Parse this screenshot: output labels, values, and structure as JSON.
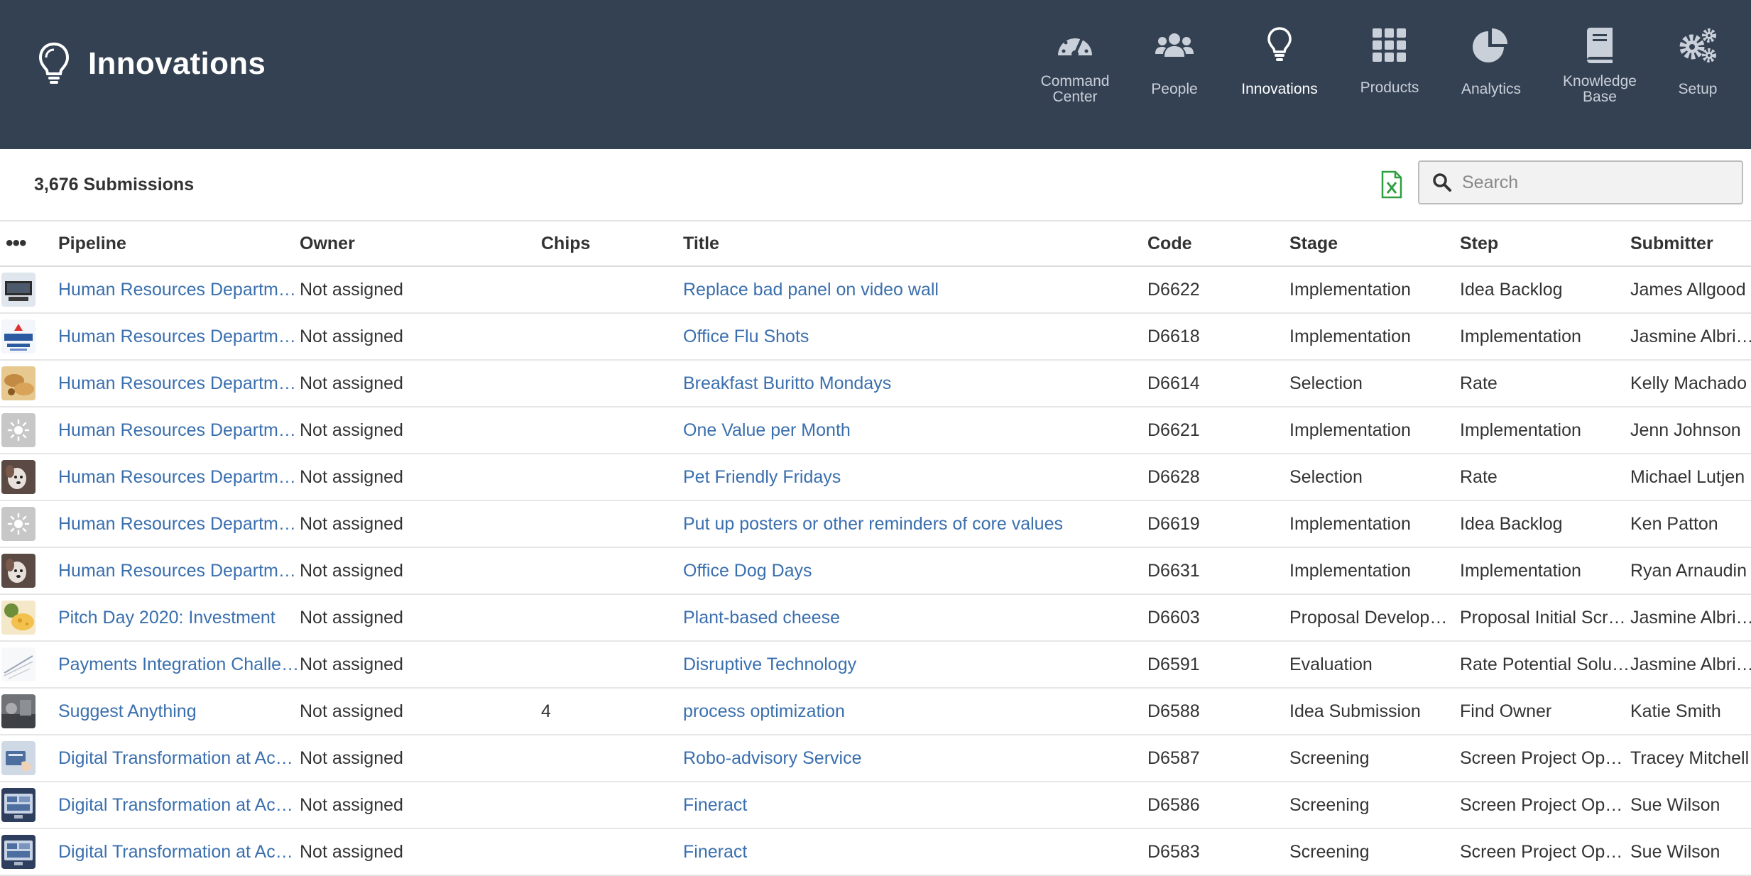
{
  "header": {
    "title": "Innovations"
  },
  "nav": {
    "items": [
      {
        "label": "Command\nCenter",
        "icon": "speedometer-icon"
      },
      {
        "label": "People",
        "icon": "people-icon"
      },
      {
        "label": "Innovations",
        "icon": "lightbulb-icon",
        "active": true
      },
      {
        "label": "Products",
        "icon": "grid-icon"
      },
      {
        "label": "Analytics",
        "icon": "pie-chart-icon"
      },
      {
        "label": "Knowledge\nBase",
        "icon": "book-icon"
      },
      {
        "label": "Setup",
        "icon": "gears-icon"
      }
    ]
  },
  "toolbar": {
    "submission_count": "3,676 Submissions",
    "export_icon": "excel-export-icon",
    "search_placeholder": "Search"
  },
  "colors": {
    "header_bg": "#344153",
    "link": "#3a6fae",
    "excel_green": "#2e9e3e"
  },
  "table": {
    "columns": {
      "menu": "•••",
      "pipeline": "Pipeline",
      "owner": "Owner",
      "chips": "Chips",
      "title": "Title",
      "code": "Code",
      "stage": "Stage",
      "step": "Step",
      "submitter": "Submitter"
    },
    "rows": [
      {
        "thumb": "monitor",
        "pipeline": "Human Resources Department",
        "owner": "Not assigned",
        "chips": "",
        "title": "Replace bad panel on video wall",
        "code": "D6622",
        "stage": "Implementation",
        "step": "Idea Backlog",
        "submitter": "James Allgood"
      },
      {
        "thumb": "onsite",
        "pipeline": "Human Resources Department",
        "owner": "Not assigned",
        "chips": "",
        "title": "Office Flu Shots",
        "code": "D6618",
        "stage": "Implementation",
        "step": "Implementation",
        "submitter": "Jasmine Albright"
      },
      {
        "thumb": "burrito",
        "pipeline": "Human Resources Department",
        "owner": "Not assigned",
        "chips": "",
        "title": "Breakfast Buritto Mondays",
        "code": "D6614",
        "stage": "Selection",
        "step": "Rate",
        "submitter": "Kelly Machado"
      },
      {
        "thumb": "bulb",
        "pipeline": "Human Resources Department",
        "owner": "Not assigned",
        "chips": "",
        "title": "One Value per Month",
        "code": "D6621",
        "stage": "Implementation",
        "step": "Implementation",
        "submitter": "Jenn Johnson"
      },
      {
        "thumb": "dog",
        "pipeline": "Human Resources Department",
        "owner": "Not assigned",
        "chips": "",
        "title": "Pet Friendly Fridays",
        "code": "D6628",
        "stage": "Selection",
        "step": "Rate",
        "submitter": "Michael Lutjen"
      },
      {
        "thumb": "bulb",
        "pipeline": "Human Resources Department",
        "owner": "Not assigned",
        "chips": "",
        "title": "Put up posters or other reminders of core values",
        "code": "D6619",
        "stage": "Implementation",
        "step": "Idea Backlog",
        "submitter": "Ken Patton"
      },
      {
        "thumb": "dog",
        "pipeline": "Human Resources Department",
        "owner": "Not assigned",
        "chips": "",
        "title": "Office Dog Days",
        "code": "D6631",
        "stage": "Implementation",
        "step": "Implementation",
        "submitter": "Ryan Arnaudin"
      },
      {
        "thumb": "cheese",
        "pipeline": "Pitch Day 2020: Investment",
        "owner": "Not assigned",
        "chips": "",
        "title": "Plant-based cheese",
        "code": "D6603",
        "stage": "Proposal Development",
        "step": "Proposal Initial Screening",
        "submitter": "Jasmine Albright"
      },
      {
        "thumb": "sketch",
        "pipeline": "Payments Integration Challenge",
        "owner": "Not assigned",
        "chips": "",
        "title": "Disruptive Technology",
        "code": "D6591",
        "stage": "Evaluation",
        "step": "Rate Potential Solutions",
        "submitter": "Jasmine Albright"
      },
      {
        "thumb": "photo",
        "pipeline": "Suggest Anything",
        "owner": "Not assigned",
        "chips": "4",
        "title": "process optimization",
        "code": "D6588",
        "stage": "Idea Submission",
        "step": "Find Owner",
        "submitter": "Katie Smith"
      },
      {
        "thumb": "robo",
        "pipeline": "Digital Transformation at Acme",
        "owner": "Not assigned",
        "chips": "",
        "title": "Robo-advisory Service",
        "code": "D6587",
        "stage": "Screening",
        "step": "Screen Project Opportunity",
        "submitter": "Tracey Mitchell"
      },
      {
        "thumb": "screen",
        "pipeline": "Digital Transformation at Acme",
        "owner": "Not assigned",
        "chips": "",
        "title": "Fineract",
        "code": "D6586",
        "stage": "Screening",
        "step": "Screen Project Opportunity",
        "submitter": "Sue Wilson"
      },
      {
        "thumb": "screen",
        "pipeline": "Digital Transformation at Acme",
        "owner": "Not assigned",
        "chips": "",
        "title": "Fineract",
        "code": "D6583",
        "stage": "Screening",
        "step": "Screen Project Opportunity",
        "submitter": "Sue Wilson"
      }
    ]
  }
}
